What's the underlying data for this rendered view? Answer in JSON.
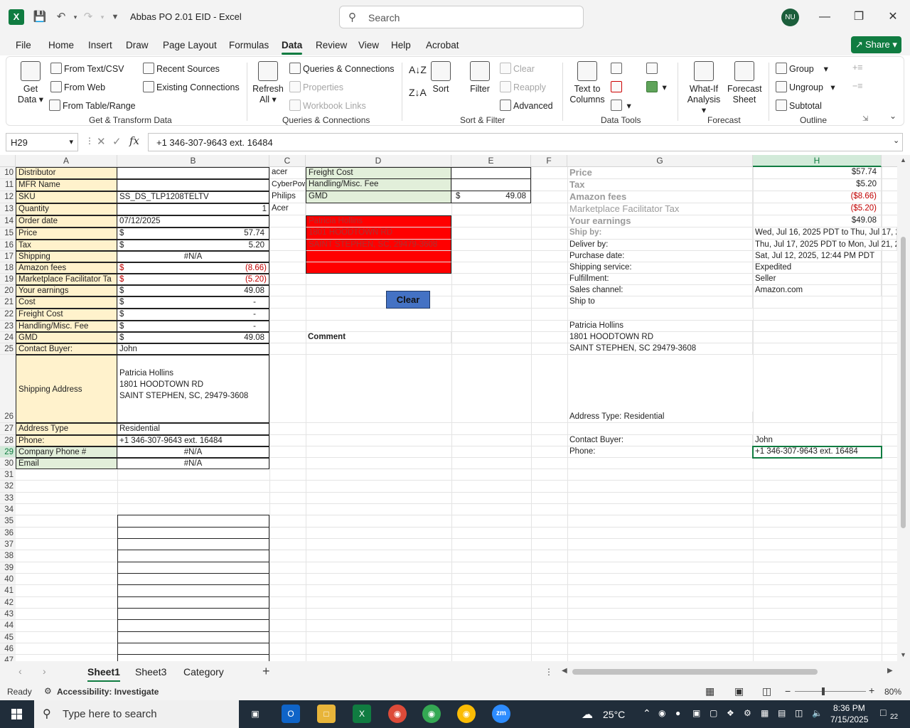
{
  "window": {
    "title": "Abbas PO 2.01 EID  -  Excel",
    "search_placeholder": "Search",
    "avatar_initials": "NU"
  },
  "menu": [
    "File",
    "Home",
    "Insert",
    "Draw",
    "Page Layout",
    "Formulas",
    "Data",
    "Review",
    "View",
    "Help",
    "Acrobat"
  ],
  "active_menu": "Data",
  "share_label": "Share",
  "ribbon": {
    "get_data": "Get",
    "get_data2": "Data",
    "from_text_csv": "From Text/CSV",
    "from_web": "From Web",
    "from_table": "From Table/Range",
    "recent_sources": "Recent Sources",
    "existing_connections": "Existing Connections",
    "group1": "Get & Transform Data",
    "refresh": "Refresh",
    "refresh_all": "All",
    "queries_connections": "Queries & Connections",
    "properties": "Properties",
    "workbook_links": "Workbook Links",
    "group2": "Queries & Connections",
    "sort": "Sort",
    "filter": "Filter",
    "clear": "Clear",
    "reapply": "Reapply",
    "advanced": "Advanced",
    "group3": "Sort & Filter",
    "text_to_columns": "Text to",
    "text_to_columns2": "Columns",
    "group4": "Data Tools",
    "what_if": "What-If",
    "what_if2": "Analysis",
    "forecast_sheet": "Forecast",
    "forecast_sheet2": "Sheet",
    "group5": "Forecast",
    "group_btn": "Group",
    "ungroup_btn": "Ungroup",
    "subtotal": "Subtotal",
    "group6": "Outline"
  },
  "formula_bar": {
    "name_box": "H29",
    "formula": "+1 346-307-9643 ext. 16484"
  },
  "columns": [
    "A",
    "B",
    "C",
    "D",
    "E",
    "F",
    "G",
    "H"
  ],
  "rows": [
    "10",
    "11",
    "12",
    "13",
    "14",
    "15",
    "16",
    "17",
    "18",
    "19",
    "20",
    "21",
    "22",
    "23",
    "24",
    "25",
    "26",
    "27",
    "28",
    "29",
    "30",
    "31",
    "32",
    "33",
    "34",
    "35",
    "36",
    "37",
    "38",
    "39",
    "40",
    "41",
    "42",
    "43",
    "44",
    "45",
    "46",
    "47"
  ],
  "colA": {
    "r10": "Distributor",
    "r11": "MFR Name",
    "r12": "SKU",
    "r13": "Quantity",
    "r14": "Order date",
    "r15": "Price",
    "r16": "Tax",
    "r17": "Shipping",
    "r18": "Amazon fees",
    "r19": "Marketplace Facilitator Ta",
    "r20": "Your earnings",
    "r21": "Cost",
    "r22": "Freight Cost",
    "r23": "Handling/Misc. Fee",
    "r24": "GMD",
    "r25": "Contact Buyer:",
    "r26": "Shipping Address",
    "r27": "Address Type",
    "r28": "Phone:",
    "r29": "Company Phone #",
    "r30": "Email"
  },
  "colB": {
    "r12": "SS_DS_TLP1208TELTV",
    "r13": "1",
    "r14": "07/12/2025",
    "dollar": "$",
    "r15": "57.74",
    "r16": "5.20",
    "r17": "#N/A",
    "r18": "(8.66)",
    "r19": "(5.20)",
    "r20": "49.08",
    "r21": "-",
    "r22": "-",
    "r23": "-",
    "r24": "49.08",
    "r25": "John",
    "addr1": "Patricia Hollins",
    "addr2": "1801 HOODTOWN RD",
    "addr3": "SAINT STEPHEN, SC, 29479-3608",
    "r27": "Residential",
    "r28": "+1 346-307-9643 ext. 16484",
    "r29": "#N/A",
    "r30": "#N/A"
  },
  "colC": {
    "r10": "acer",
    "r11": "CyberPow",
    "r12": "Philips",
    "r13": "Acer"
  },
  "colD": {
    "r10": "Freight Cost",
    "r11": "Handling/Misc. Fee",
    "r12": "GMD",
    "red1": "Patricia Hollins",
    "red2": "1801 HOODTOWN RD",
    "red3": "SAINT STEPHEN, SC, 29479-3608",
    "comment": "Comment"
  },
  "colE": {
    "dollar": "$",
    "r12": "49.08"
  },
  "clear_button": "Clear",
  "colG": {
    "r10": "Price",
    "r11": "Tax",
    "r12": "Amazon fees",
    "r13": "Marketplace Facilitator Tax",
    "r14": "Your earnings",
    "r15": "Ship by:",
    "r16": "Deliver by:",
    "r17": "Purchase date:",
    "r18": "Shipping service:",
    "r19": "Fulfillment:",
    "r20": "Sales channel:",
    "r21": "Ship to",
    "name": "Patricia Hollins",
    "street": "1801 HOODTOWN RD",
    "city": "SAINT STEPHEN, SC 29479-3608",
    "addr_type": "Address Type:  Residential",
    "r28": "Contact Buyer:",
    "r29": "Phone:"
  },
  "colH": {
    "r10": "$57.74",
    "r11": "$5.20",
    "r12": "($8.66)",
    "r13": "($5.20)",
    "r14": "$49.08",
    "r15": "Wed, Jul 16, 2025 PDT to Thu, Jul 17, 2",
    "r16": "Thu, Jul 17, 2025 PDT to Mon, Jul 21, 2",
    "r17": "Sat, Jul 12, 2025, 12:44 PM PDT",
    "r18": "Expedited",
    "r19": "Seller",
    "r20": "Amazon.com",
    "r28": "John",
    "r29": "+1 346-307-9643 ext. 16484"
  },
  "sheets": [
    "Sheet1",
    "Sheet3",
    "Category"
  ],
  "active_sheet": "Sheet1",
  "status": {
    "ready": "Ready",
    "accessibility": "Accessibility: Investigate",
    "zoom": "80%"
  },
  "taskbar": {
    "search_placeholder": "Type here to search",
    "weather": "25°C",
    "time": "8:36 PM",
    "date": "7/15/2025",
    "notification_count": "22"
  },
  "colors": {
    "excel_green": "#107c41",
    "label_fill": "#fff2cc",
    "green_fill": "#e2efda",
    "red_fill": "#ff0000",
    "button_blue": "#4472c4"
  }
}
